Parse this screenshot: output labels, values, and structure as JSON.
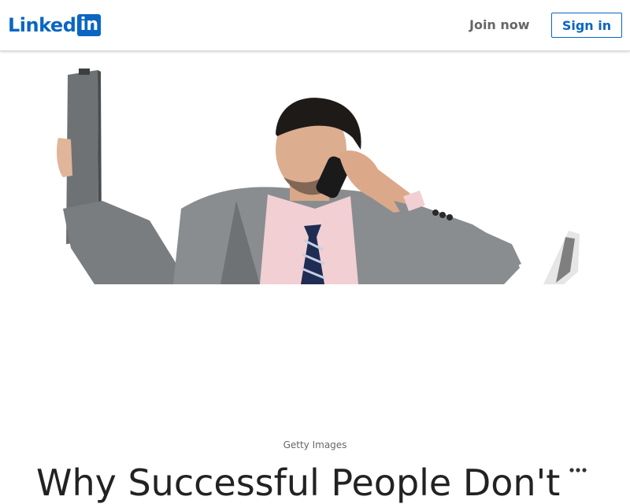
{
  "header": {
    "logo_text": "Linked",
    "logo_box_text": "in",
    "join_label": "Join now",
    "signin_label": "Sign in"
  },
  "hero": {
    "image_icon": "businessman-on-phone-photo"
  },
  "article": {
    "image_credit": "Getty Images",
    "title": "Why Successful People Don't",
    "more_icon": "more-horizontal-icon"
  },
  "colors": {
    "brand": "#0a66c2",
    "muted_text": "#666666"
  }
}
